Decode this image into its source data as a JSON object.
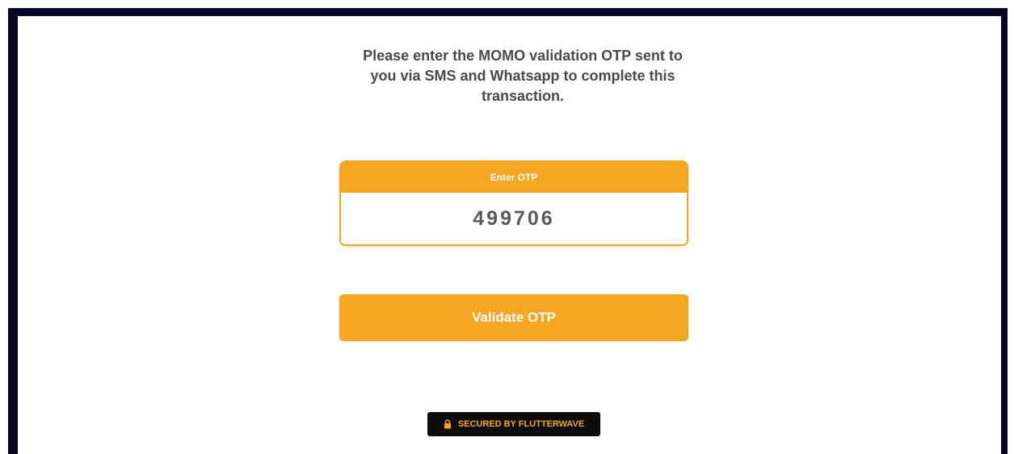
{
  "instruction": "Please enter the MOMO validation OTP sent to you via SMS and Whatsapp to complete this transaction.",
  "otp": {
    "header_label": "Enter OTP",
    "value": "499706"
  },
  "validate_button_label": "Validate OTP",
  "badge": {
    "icon": "lock-icon",
    "label": "SECURED BY FLUTTERWAVE"
  },
  "colors": {
    "accent": "#f5a623",
    "frame": "#070625",
    "badge_bg": "#0d0d0d",
    "text": "#4a4a4a"
  }
}
